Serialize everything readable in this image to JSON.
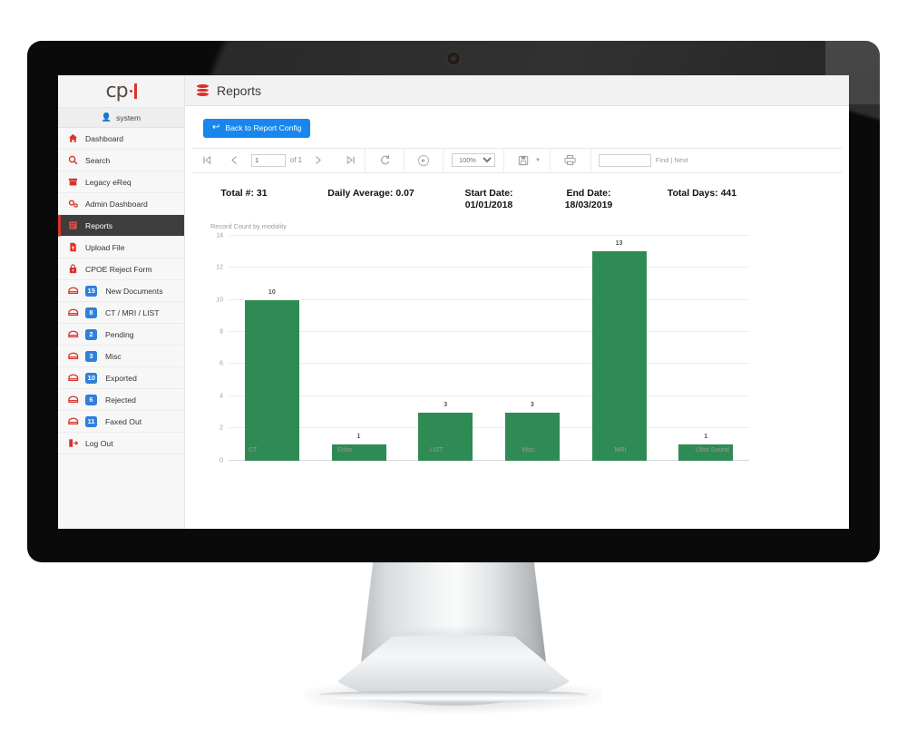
{
  "app": {
    "logo_text": "cp",
    "user": "system",
    "user_icon": "user-icon"
  },
  "sidebar": {
    "items": [
      {
        "label": "Dashboard",
        "icon": "home-icon",
        "badge": null,
        "active": false
      },
      {
        "label": "Search",
        "icon": "search-icon",
        "badge": null,
        "active": false
      },
      {
        "label": "Legacy eReq",
        "icon": "inbox-icon",
        "badge": null,
        "active": false
      },
      {
        "label": "Admin Dashboard",
        "icon": "gears-icon",
        "badge": null,
        "active": false
      },
      {
        "label": "Reports",
        "icon": "report-grid-icon",
        "badge": null,
        "active": true
      },
      {
        "label": "Upload File",
        "icon": "upload-file-icon",
        "badge": null,
        "active": false
      },
      {
        "label": "CPOE Reject Form",
        "icon": "lock-form-icon",
        "badge": null,
        "active": false
      },
      {
        "label": "New Documents",
        "icon": "mailbox-icon",
        "badge": "15",
        "active": false
      },
      {
        "label": "CT / MRI / LIST",
        "icon": "mailbox-icon",
        "badge": "8",
        "active": false
      },
      {
        "label": "Pending",
        "icon": "mailbox-icon",
        "badge": "2",
        "active": false
      },
      {
        "label": "Misc",
        "icon": "mailbox-icon",
        "badge": "3",
        "active": false
      },
      {
        "label": "Exported",
        "icon": "mailbox-icon",
        "badge": "10",
        "active": false
      },
      {
        "label": "Rejected",
        "icon": "mailbox-icon",
        "badge": "6",
        "active": false
      },
      {
        "label": "Faxed Out",
        "icon": "mailbox-icon",
        "badge": "11",
        "active": false
      },
      {
        "label": "Log Out",
        "icon": "logout-icon",
        "badge": null,
        "active": false
      }
    ]
  },
  "header": {
    "title": "Reports",
    "icon": "database-icon"
  },
  "actions": {
    "back_button": "Back to Report Config",
    "back_icon": "back-arrow-icon"
  },
  "viewer_toolbar": {
    "first_page_icon": "first-page-icon",
    "prev_page_icon": "previous-page-icon",
    "page_value": "1",
    "page_of": "of 1",
    "next_page_icon": "next-page-icon",
    "last_page_icon": "last-page-icon",
    "refresh_icon": "refresh-icon",
    "back_to_parent_icon": "back-to-parent-icon",
    "zoom_value": "100%",
    "zoom_options": [
      "100%"
    ],
    "export_icon": "save-export-icon",
    "print_icon": "print-icon",
    "find_value": "",
    "find_placeholder": "",
    "find_links": "Find | Next"
  },
  "summary": {
    "total": "Total #: 31",
    "daily_average": "Daily Average: 0.07",
    "start_date_label": "Start Date:",
    "start_date_value": "01/01/2018",
    "end_date_label": "End Date:",
    "end_date_value": "18/03/2019",
    "total_days": "Total Days: 441"
  },
  "colors": {
    "bar_green": "#2f8b54",
    "accent_red": "#d9342b",
    "primary_blue": "#1787ee",
    "badge_blue": "#2f7fdd"
  },
  "chart_data": {
    "type": "bar",
    "title": "Record Count by modality",
    "xlabel": "",
    "ylabel": "",
    "categories": [
      "CT",
      "Echo",
      "LIST",
      "Misc",
      "MRI",
      "Ultra Sound"
    ],
    "values": [
      10,
      1,
      3,
      3,
      13,
      1
    ],
    "value_labels": [
      "10",
      "1",
      "3",
      "3",
      "13",
      "1"
    ],
    "yticks": [
      0,
      2,
      4,
      6,
      8,
      10,
      12,
      14
    ],
    "ytick_labels": [
      "0",
      "2",
      "4",
      "6",
      "8",
      "10",
      "12",
      "14"
    ],
    "ylim": [
      0,
      14
    ],
    "grid": true,
    "legend": false,
    "series_color": "#2f8b54"
  }
}
